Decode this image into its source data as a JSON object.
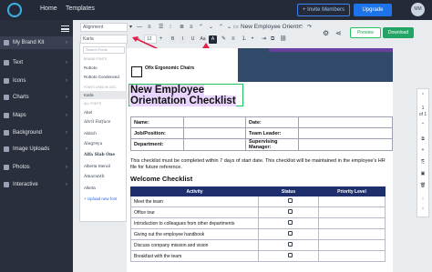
{
  "topbar": {
    "nav": [
      "Home",
      "Templates"
    ],
    "invite_label": "+ Invite Members",
    "upgrade_label": "Upgrade",
    "avatar_initials": "MM"
  },
  "sidebar": {
    "items": [
      {
        "label": "My Brand Kit",
        "icon": "brand-icon"
      },
      {
        "label": "Text",
        "icon": "text-icon"
      },
      {
        "label": "Icons",
        "icon": "icons-icon"
      },
      {
        "label": "Charts",
        "icon": "chart-icon"
      },
      {
        "label": "Maps",
        "icon": "map-icon"
      },
      {
        "label": "Background",
        "icon": "background-icon"
      },
      {
        "label": "Image Uploads",
        "icon": "upload-icon"
      },
      {
        "label": "Photos",
        "icon": "photo-icon"
      },
      {
        "label": "Interactive",
        "icon": "interactive-icon"
      }
    ]
  },
  "toolbar": {
    "alignment_value": "Alignment",
    "font_value": "Karla",
    "font_size": "12",
    "doc_title": "New Employee Orient...",
    "preview_label": "Preview",
    "download_label": "Download"
  },
  "font_panel": {
    "search_placeholder": "Search Fonts",
    "brand_heading": "BRAND FONTS",
    "brand_fonts": [
      "Roboto",
      "Roboto Condensed"
    ],
    "used_heading": "FONTS USED IN DOC",
    "used_fonts": [
      "Karla"
    ],
    "all_heading": "ALL FONTS",
    "all_fonts": [
      "Abel",
      "Abril Fatface",
      "Aldrich",
      "Alegreya",
      "Alfa Slab One",
      "Alberta Stencil",
      "Amaranth",
      "Allerta"
    ],
    "upload_label": "+ Upload new font"
  },
  "document": {
    "logo_text": "Ofix Ergonomic Chairs",
    "title_line1": "New Employee",
    "title_line2": "Orientation Checklist",
    "form": {
      "name": "Name:",
      "date": "Date:",
      "job": "Job/Position:",
      "team_leader": "Team Leader:",
      "department": "Department:",
      "supervising": "Supervising Manager:"
    },
    "paragraph": "This checklist must be completed within 7 days of start date. This checklist will be maintained in the employee's HR file for future reference.",
    "section_title": "Welcome Checklist",
    "table_headers": [
      "Activity",
      "Status",
      "Priority Level"
    ],
    "activities": [
      "Meet the team",
      "Office tour",
      "Introduction to colleagues from other departments",
      "Giving out the employee handbook",
      "Discuss company mission and vision",
      "Breakfast with the team"
    ]
  },
  "right_tools": {
    "page_label": "1",
    "page_of": "of 1"
  },
  "colors": {
    "topbar": "#242a38",
    "sidebar": "#2a2f3d",
    "accent_blue": "#1d74ea",
    "download_green": "#22a565",
    "table_header": "#1f2f6e",
    "annotation_arrow": "#e11d48"
  }
}
